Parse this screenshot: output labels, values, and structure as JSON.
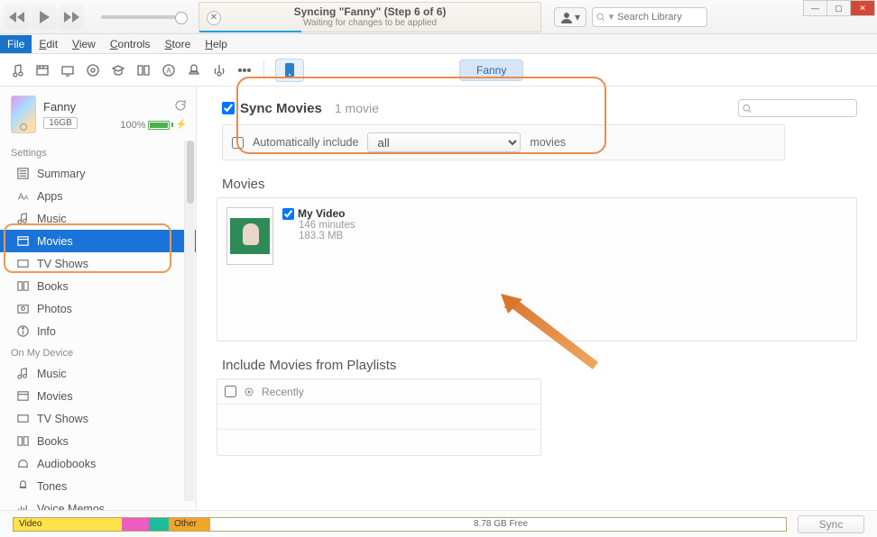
{
  "window": {
    "min": "—",
    "max": "▢",
    "close": "✕"
  },
  "player": {
    "title": "Syncing \"Fanny\" (Step 6 of 6)",
    "subtitle": "Waiting for changes to be applied"
  },
  "search_library": {
    "placeholder": "Search Library"
  },
  "menubar": {
    "file": "File",
    "edit": "Edit",
    "view": "View",
    "controls": "Controls",
    "store": "Store",
    "help": "Help"
  },
  "device_tab": {
    "name": "Fanny"
  },
  "device": {
    "name": "Fanny",
    "capacity": "16GB",
    "battery_pct": "100%"
  },
  "sidebar": {
    "settings_label": "Settings",
    "onmydevice_label": "On My Device",
    "settings": [
      {
        "label": "Summary"
      },
      {
        "label": "Apps"
      },
      {
        "label": "Music"
      },
      {
        "label": "Movies"
      },
      {
        "label": "TV Shows"
      },
      {
        "label": "Books"
      },
      {
        "label": "Photos"
      },
      {
        "label": "Info"
      }
    ],
    "onmydevice": [
      {
        "label": "Music"
      },
      {
        "label": "Movies"
      },
      {
        "label": "TV Shows"
      },
      {
        "label": "Books"
      },
      {
        "label": "Audiobooks"
      },
      {
        "label": "Tones"
      },
      {
        "label": "Voice Memos"
      }
    ]
  },
  "sync": {
    "title": "Sync Movies",
    "count": "1 movie",
    "auto_label": "Automatically include",
    "auto_value": "all",
    "auto_suffix": "movies"
  },
  "movies": {
    "heading": "Movies",
    "item": {
      "title": "My Video",
      "duration": "146 minutes",
      "size": "183.3 MB"
    }
  },
  "playlists": {
    "heading": "Include Movies from Playlists",
    "row0": "Recently"
  },
  "storage": {
    "video_label": "Video",
    "other_label": "Other",
    "free_label": "8.78 GB Free",
    "sync_btn": "Sync"
  }
}
